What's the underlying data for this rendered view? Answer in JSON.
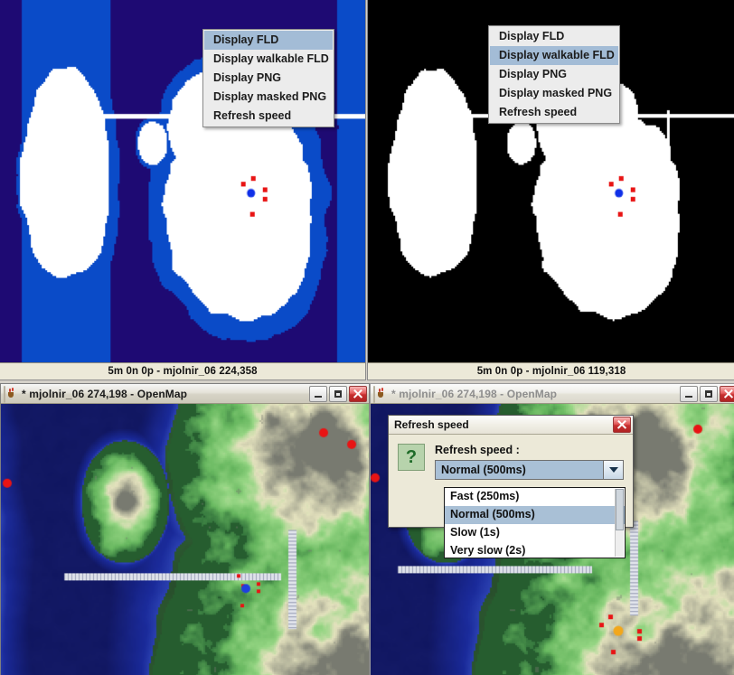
{
  "app": {
    "name": "OpenMap"
  },
  "windows": {
    "top_left": {
      "status": "5m 0n 0p  - mjolnir_06 224,358",
      "menu": {
        "items": [
          {
            "label": "Display FLD",
            "selected": true
          },
          {
            "label": "Display walkable FLD",
            "selected": false
          },
          {
            "label": "Display PNG",
            "selected": false
          },
          {
            "label": "Display masked PNG",
            "selected": false
          },
          {
            "label": "Refresh speed",
            "selected": false
          }
        ]
      },
      "map": {
        "mode": "FLD",
        "colors": {
          "water_shallow": "#0A4BC8",
          "water_deep": "#1E0A73",
          "land": "#FFFFFF",
          "marker_red": "#E81414",
          "marker_blue": "#1030E8"
        }
      }
    },
    "top_right": {
      "status": "5m 0n 0p  - mjolnir_06 119,318",
      "menu": {
        "items": [
          {
            "label": "Display FLD",
            "selected": false
          },
          {
            "label": "Display walkable FLD",
            "selected": true
          },
          {
            "label": "Display PNG",
            "selected": false
          },
          {
            "label": "Display masked PNG",
            "selected": false
          },
          {
            "label": "Refresh speed",
            "selected": false
          }
        ]
      },
      "map": {
        "mode": "walkable FLD",
        "colors": {
          "blocked": "#000000",
          "walkable": "#FFFFFF",
          "marker_red": "#E81414",
          "marker_blue": "#1030E8"
        }
      }
    },
    "bottom_left": {
      "title": "* mjolnir_06 274,198 - OpenMap",
      "icon": "java-icon",
      "buttons": [
        "minimize",
        "maximize",
        "close"
      ],
      "active": true,
      "map": {
        "mode": "PNG"
      }
    },
    "bottom_right": {
      "title": "* mjolnir_06 274,198 - OpenMap",
      "icon": "java-icon",
      "buttons": [
        "minimize",
        "maximize",
        "close"
      ],
      "active": false,
      "map": {
        "mode": "PNG"
      }
    }
  },
  "dialog": {
    "title": "Refresh speed",
    "close_label": "Close",
    "icon": "question-icon",
    "icon_glyph": "?",
    "field_label": "Refresh speed :",
    "selected_value": "Normal (500ms)",
    "options": [
      {
        "label": "Fast (250ms)",
        "selected": false
      },
      {
        "label": "Normal (500ms)",
        "selected": true
      },
      {
        "label": "Slow (1s)",
        "selected": false
      },
      {
        "label": "Very slow (2s)",
        "selected": false
      }
    ]
  }
}
